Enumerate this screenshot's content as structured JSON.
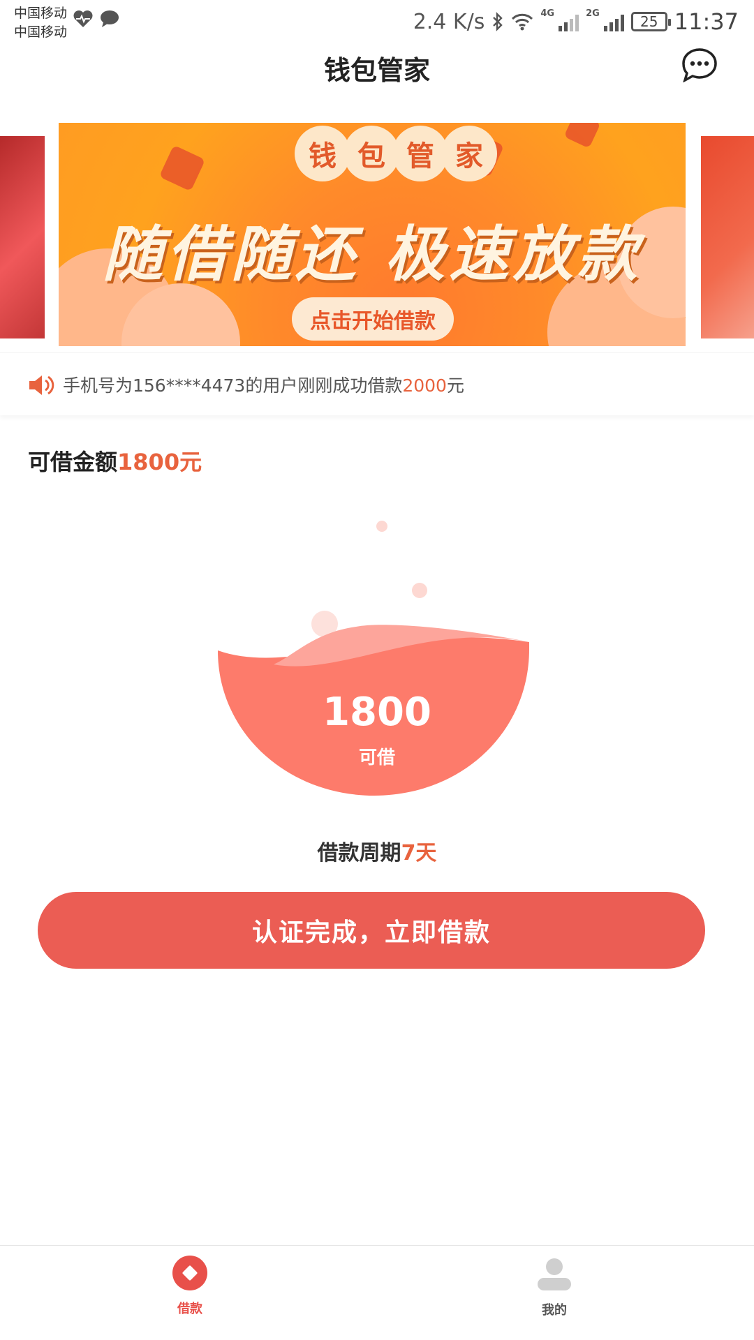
{
  "status_bar": {
    "carrier_1": "中国移动",
    "carrier_2": "中国移动",
    "net_speed": "2.4 K/s",
    "network_1": "4G",
    "network_2": "2G",
    "battery": "25",
    "time": "11:37",
    "left_icons": [
      "heart-rate-icon",
      "chat-bubble-icon"
    ],
    "right_icons": [
      "bluetooth-icon",
      "wifi-icon",
      "signal-icon",
      "signal-icon",
      "battery-icon"
    ]
  },
  "header": {
    "title": "钱包管家",
    "menu_icon": "more-chat-icon"
  },
  "banner": {
    "brand_chars": [
      "钱",
      "包",
      "管",
      "家"
    ],
    "headline": "随借随还 极速放款",
    "cta": "点击开始借款",
    "colors": {
      "primary": "#ff9a22",
      "accent": "#e8542a",
      "cream": "#fde9d2"
    }
  },
  "notice": {
    "icon": "speaker-icon",
    "prefix": "手机号为156****4473的用户刚刚成功借款",
    "amount": "2000",
    "suffix": "元"
  },
  "available": {
    "label": "可借金额",
    "amount": "1800元",
    "bowl_value": "1800",
    "bowl_caption": "可借"
  },
  "period": {
    "label": "借款周期",
    "value": "7天"
  },
  "action": {
    "button_label": "认证完成，立即借款"
  },
  "bottom_nav": {
    "items": [
      {
        "label": "借款",
        "icon": "loan-diamond-icon",
        "active": true
      },
      {
        "label": "我的",
        "icon": "person-icon",
        "active": false
      }
    ]
  },
  "colors": {
    "accent": "#e8633e",
    "button": "#eb5d54",
    "bowl": "#fd7b6b",
    "text_dark": "#222222"
  }
}
